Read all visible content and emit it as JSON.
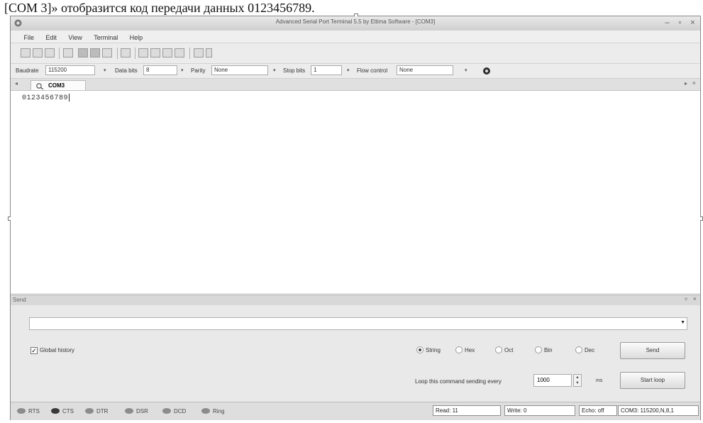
{
  "caption": "[COM 3]» отобразится код передачи данных 0123456789.",
  "window": {
    "title": "Advanced Serial Port Terminal 5.5 by Eltima Software - [COM3]",
    "controls": {
      "minimize": "–",
      "restore": "▫",
      "close": "×"
    }
  },
  "menu": [
    "File",
    "Edit",
    "View",
    "Terminal",
    "Help"
  ],
  "settings": {
    "baudrate": {
      "label": "Baudrate",
      "value": "115200"
    },
    "databits": {
      "label": "Data bits",
      "value": "8"
    },
    "parity": {
      "label": "Parity",
      "value": "None"
    },
    "stopbits": {
      "label": "Stop bits",
      "value": "1"
    },
    "flow": {
      "label": "Flow control",
      "value": "None"
    }
  },
  "tab": {
    "label": "COM3"
  },
  "terminal": {
    "output": "0123456789"
  },
  "send": {
    "header": "Send",
    "global_history": "Global history",
    "modes": [
      "String",
      "Hex",
      "Oct",
      "Bin",
      "Dec"
    ],
    "selected_mode": "String",
    "send_button": "Send",
    "loop_label": "Loop this command sending every",
    "loop_value": "1000",
    "loop_unit": "ms",
    "start_loop_button": "Start loop"
  },
  "status": {
    "signals": [
      "RTS",
      "CTS",
      "DTR",
      "DSR",
      "DCD",
      "Ring"
    ],
    "active_signal": "CTS",
    "read": "Read: 11",
    "write": "Write: 0",
    "echo": "Echo: off",
    "port": "COM3: 115200,N,8,1"
  },
  "colors": {
    "led_on": "#3a3a3a",
    "led_off": "#8c8c8c",
    "window_bg": "#e6e6e6"
  }
}
